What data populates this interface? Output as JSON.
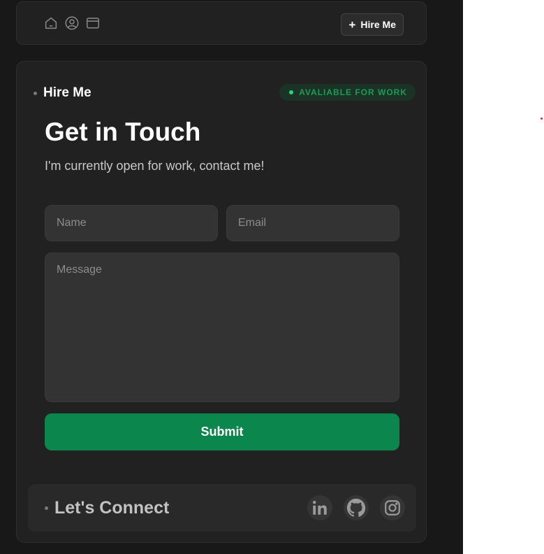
{
  "topbar": {
    "nav_icons": [
      "home-icon",
      "user-icon",
      "window-icon"
    ],
    "hire_button": {
      "icon": "plus-icon",
      "plus_glyph": "+",
      "label": "Hire Me"
    }
  },
  "contact_card": {
    "section_label": "Hire Me",
    "status_badge": "AVALIABLE FOR WORK",
    "title": "Get in Touch",
    "subtitle": "I'm currently open for work, contact me!",
    "form": {
      "name_placeholder": "Name",
      "email_placeholder": "Email",
      "message_placeholder": "Message",
      "submit_label": "Submit"
    },
    "connect": {
      "title": "Let's Connect",
      "socials": [
        "linkedin-icon",
        "github-icon",
        "instagram-icon"
      ]
    }
  },
  "colors": {
    "background": "#181818",
    "card": "#212121",
    "field": "#333333",
    "accent_green": "#0b874e",
    "status_green": "#2ed47a"
  }
}
